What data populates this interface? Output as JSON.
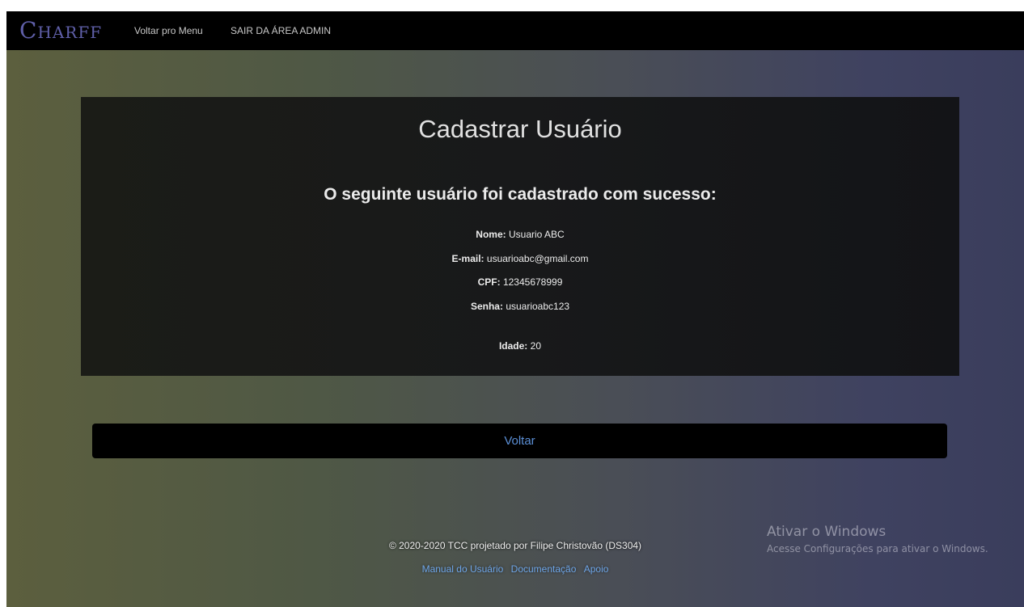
{
  "header": {
    "brand": "Charff",
    "nav": {
      "menu_label": "Voltar pro Menu",
      "admin_label": "SAIR DA ÁREA ADMIN"
    }
  },
  "card": {
    "title": "Cadastrar Usuário",
    "subtitle": "O seguinte usuário foi cadastrado com sucesso:",
    "fields": {
      "nome": {
        "label": "Nome:",
        "value": "Usuario ABC"
      },
      "email": {
        "label": "E-mail:",
        "value": "usuarioabc@gmail.com"
      },
      "cpf": {
        "label": "CPF:",
        "value": "12345678999"
      },
      "senha": {
        "label": "Senha:",
        "value": "usuarioabc123"
      },
      "idade": {
        "label": "Idade:",
        "value": "20"
      }
    }
  },
  "actions": {
    "back_label": "Voltar"
  },
  "footer": {
    "copyright": "© 2020-2020 TCC projetado por Filipe Christovão (DS304)",
    "links": {
      "manual": "Manual do Usuário",
      "docs": "Documentação",
      "support": "Apoio"
    }
  },
  "watermark": {
    "title": "Ativar o Windows",
    "subtitle": "Acesse Configurações para ativar o Windows."
  },
  "colors": {
    "brand": "#5f5fa8",
    "link": "#6ea6e8",
    "button_text": "#5b8fd6",
    "card_bg": "#18191a",
    "topbar_bg": "#000000"
  }
}
